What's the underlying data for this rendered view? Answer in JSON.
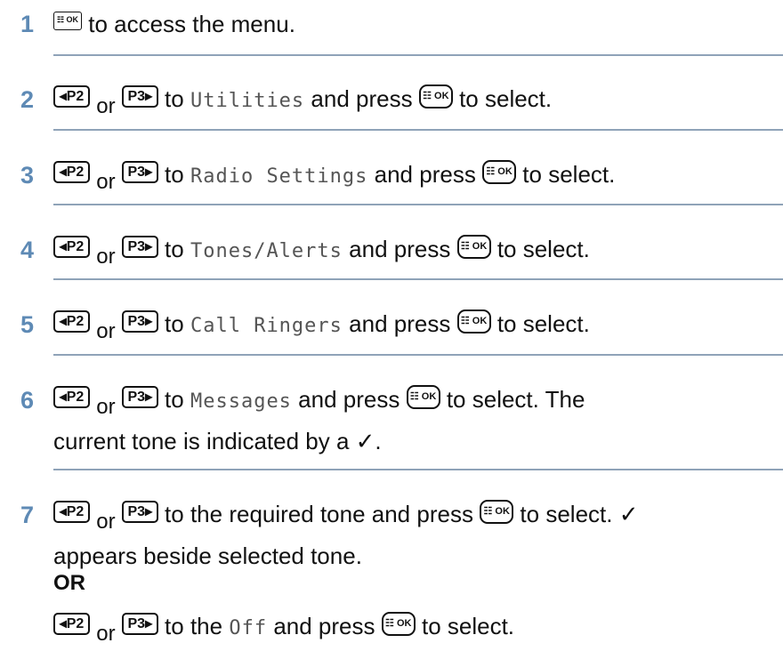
{
  "keys": {
    "ok": "☷ OK",
    "p2": "◂P2",
    "p3": "P3▸"
  },
  "steps": [
    {
      "num": "1",
      "text": "to access the menu."
    },
    {
      "num": "2",
      "or": "or",
      "to": "to",
      "item": "Utilities",
      "press": "and press",
      "end": "to select."
    },
    {
      "num": "3",
      "or": "or",
      "to": "to",
      "item": "Radio Settings",
      "press": "and press",
      "end": "to select."
    },
    {
      "num": "4",
      "or": "or",
      "to": "to",
      "item": "Tones/Alerts",
      "press": "and press",
      "end": "to select."
    },
    {
      "num": "5",
      "or": "or",
      "to": "to",
      "item": "Call Ringers",
      "press": "and press",
      "end": "to select."
    },
    {
      "num": "6",
      "or": "or",
      "to": "to",
      "item": "Messages",
      "press": "and press",
      "end": "to select. The",
      "line2": "current tone is indicated by a ✓."
    },
    {
      "num": "7",
      "or": "or",
      "to": "to the required tone and press",
      "end": "to select. ✓",
      "line2": "appears beside selected tone.",
      "alt_label": "OR",
      "alt_or": "or",
      "alt_to": "to the",
      "alt_item": "Off",
      "alt_press": "and press",
      "alt_end": "to select."
    }
  ]
}
